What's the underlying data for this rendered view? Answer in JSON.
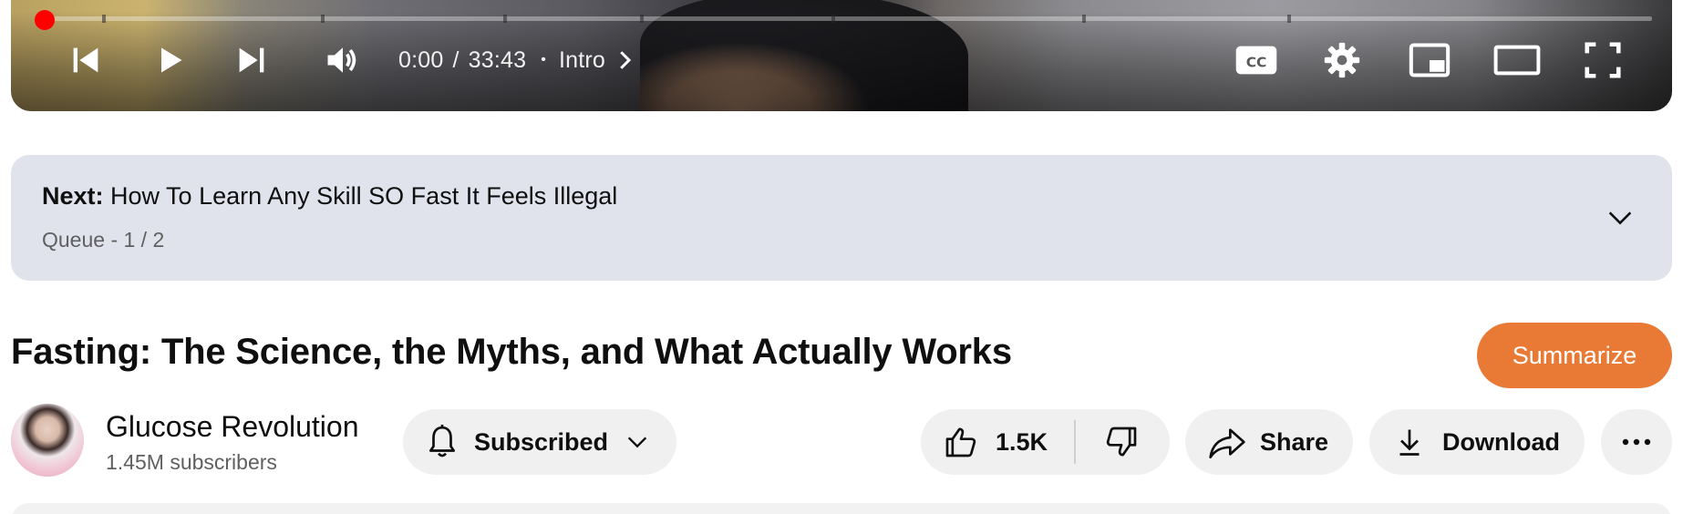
{
  "player": {
    "time_current": "0:00",
    "time_separator": "/",
    "time_total": "33:43",
    "chapter_separator": "•",
    "chapter_label": "Intro",
    "progress_fraction": 0.0,
    "icons": {
      "previous": "skip-previous-icon",
      "play": "play-icon",
      "next": "skip-next-icon",
      "volume": "volume-icon",
      "chapter_chevron": "chevron-right-icon",
      "captions": "closed-captions-icon",
      "settings": "gear-icon",
      "miniplayer": "miniplayer-icon",
      "theater": "theater-mode-icon",
      "fullscreen": "fullscreen-icon"
    },
    "accent_color": "#ff0000"
  },
  "queue": {
    "next_label": "Next:",
    "next_title": "How To Learn Any Skill SO Fast It Feels Illegal",
    "queue_text": "Queue - 1 / 2",
    "expand_icon": "chevron-down-icon",
    "background_color": "#e0e3ec"
  },
  "video": {
    "title": "Fasting: The Science, the Myths, and What Actually Works",
    "summarize_label": "Summarize",
    "summarize_color": "#e97a35"
  },
  "channel": {
    "name": "Glucose Revolution",
    "subscribers": "1.45M subscribers",
    "subscribed_label": "Subscribed",
    "bell_icon": "bell-icon",
    "dropdown_icon": "chevron-down-icon"
  },
  "actions": {
    "like_count": "1.5K",
    "like_icon": "thumbs-up-icon",
    "dislike_icon": "thumbs-down-icon",
    "share_label": "Share",
    "share_icon": "share-arrow-icon",
    "download_label": "Download",
    "download_icon": "download-icon",
    "more_icon": "more-horizontal-icon"
  }
}
